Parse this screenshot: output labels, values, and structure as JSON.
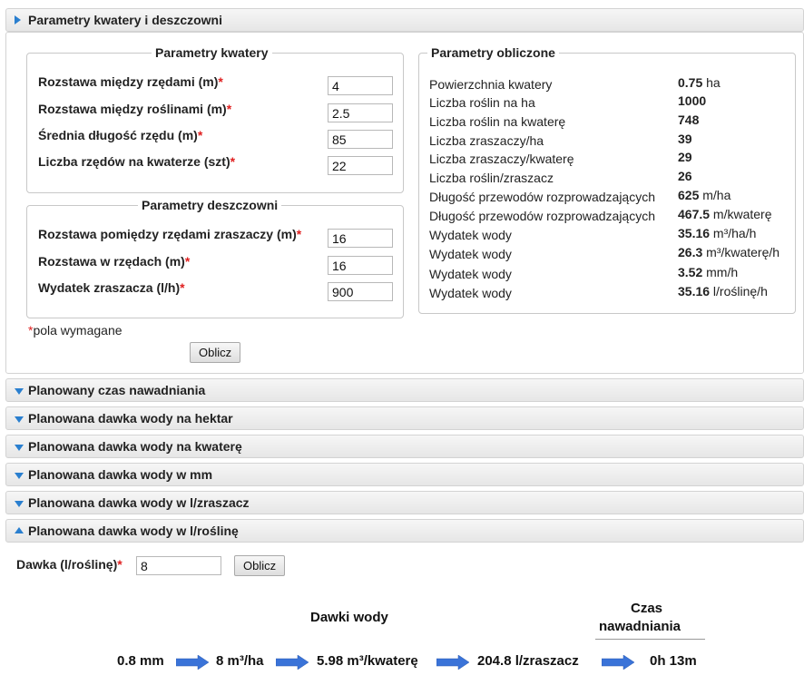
{
  "accordion": {
    "section1": "Parametry kwatery i deszczowni",
    "section2": "Planowany czas nawadniania",
    "section3": "Planowana dawka wody na hektar",
    "section4": "Planowana dawka wody na kwaterę",
    "section5": "Planowana dawka wody w mm",
    "section6": "Planowana dawka wody w l/zraszacz",
    "section7": "Planowana dawka wody w l/roślinę"
  },
  "kwatera": {
    "legend": "Parametry kwatery",
    "rows": [
      {
        "label": "Rozstawa między rzędami (m)",
        "value": "4"
      },
      {
        "label": "Rozstawa między roślinami (m)",
        "value": "2.5"
      },
      {
        "label": "Średnia długość rzędu (m)",
        "value": "85"
      },
      {
        "label": "Liczba rzędów na kwaterze (szt)",
        "value": "22"
      }
    ]
  },
  "deszczownia": {
    "legend": "Parametry deszczowni",
    "rows": [
      {
        "label": "Rozstawa pomiędzy rzędami zraszaczy (m)",
        "value": "16"
      },
      {
        "label": "Rozstawa w rzędach (m)",
        "value": "16"
      },
      {
        "label": "Wydatek zraszacza (l/h)",
        "value": "900"
      }
    ]
  },
  "required_star": "*",
  "required_note": "pola wymagane",
  "oblicz_label": "Oblicz",
  "obliczone": {
    "legend": "Parametry obliczone",
    "rows": [
      {
        "label": "Powierzchnia kwatery",
        "value": "0.75",
        "unit": " ha"
      },
      {
        "label": "Liczba roślin na ha",
        "value": "1000",
        "unit": ""
      },
      {
        "label": "Liczba roślin na kwaterę",
        "value": "748",
        "unit": ""
      },
      {
        "label": "Liczba zraszaczy/ha",
        "value": "39",
        "unit": ""
      },
      {
        "label": "Liczba zraszaczy/kwaterę",
        "value": "29",
        "unit": ""
      },
      {
        "label": "Liczba roślin/zraszacz",
        "value": "26",
        "unit": ""
      },
      {
        "label": "Długość przewodów rozprowadzających",
        "value": "625",
        "unit": " m/ha"
      },
      {
        "label": "Długość przewodów rozprowadzających",
        "value": "467.5",
        "unit": " m/kwaterę"
      },
      {
        "label": "Wydatek wody",
        "value": "35.16",
        "unit": " m³/ha/h"
      },
      {
        "label": "Wydatek wody",
        "value": "26.3",
        "unit": " m³/kwaterę/h"
      },
      {
        "label": "Wydatek wody",
        "value": "3.52",
        "unit": " mm/h"
      },
      {
        "label": "Wydatek wody",
        "value": "35.16",
        "unit": " l/roślinę/h"
      }
    ]
  },
  "dawka": {
    "label": "Dawka (l/roślinę)",
    "value": "8",
    "button": "Oblicz"
  },
  "results": {
    "dawki_header": "Dawki wody",
    "czas_header_1": "Czas",
    "czas_header_2": "nawadniania",
    "mm": "0.8 mm",
    "ha": "8 m³/ha",
    "kwatera": "5.98 m³/kwaterę",
    "zraszacz": "204.8 l/zraszacz",
    "czas": "0h 13m"
  },
  "colors": {
    "accent_arrow": "#3a73d8",
    "required": "#e02020",
    "triangle": "#2a7fcf"
  }
}
